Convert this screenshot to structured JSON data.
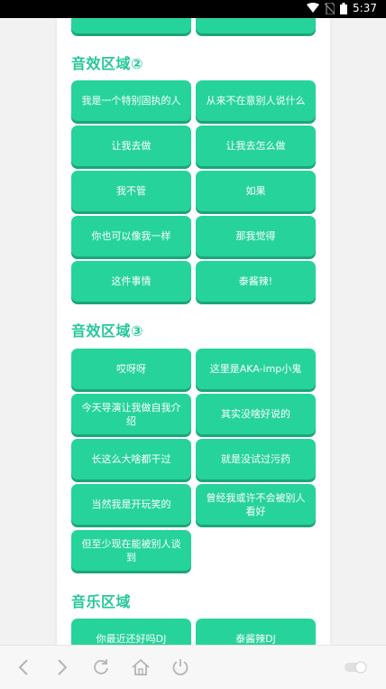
{
  "status": {
    "time": "5:37"
  },
  "sections": [
    {
      "title": "音效区域②",
      "buttons": [
        "我是一个特别固执的人",
        "从来不在意别人说什么",
        "让我去做",
        "让我去怎么做",
        "我不管",
        "如果",
        "你也可以像我一样",
        "那我觉得",
        "这件事情",
        "泰酱辣!"
      ]
    },
    {
      "title": "音效区域③",
      "buttons": [
        "哎呀呀",
        "这里是AKA-imp小鬼",
        "今天导演让我做自我介绍",
        "其实没啥好说的",
        "长这么大啥都干过",
        "就是没试过污药",
        "当然我是开玩笑的",
        "曾经我或许不会被别人看好",
        "但至少现在能被别人谈到"
      ]
    },
    {
      "title": "音乐区域",
      "buttons": [
        "你最近还好吗DJ",
        "泰酱辣DJ"
      ]
    }
  ],
  "colors": {
    "accent": "#26d39b",
    "title": "#26c79a"
  },
  "icons": [
    "back-icon",
    "forward-icon",
    "refresh-icon",
    "home-icon",
    "power-icon",
    "toggle-icon"
  ]
}
